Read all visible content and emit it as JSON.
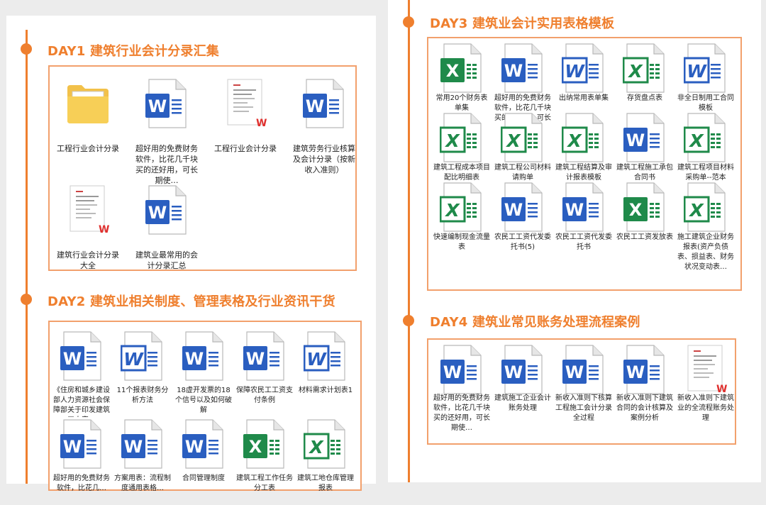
{
  "sections": {
    "day1": {
      "title": "DAY1 建筑行业会计分录汇集",
      "items": [
        {
          "label": "工程行业会计分录",
          "icon": "folder-icon"
        },
        {
          "label": "超好用的免费财务软件，比花几千块买的还好用，可长期使…",
          "icon": "word-icon"
        },
        {
          "label": "工程行业会计分录",
          "icon": "wps-document-icon"
        },
        {
          "label": "建筑劳务行业核算及会计分录（按新收入准则）",
          "icon": "word-icon"
        },
        {
          "label": "建筑行业会计分录大全",
          "icon": "wps-document-icon"
        },
        {
          "label": "建筑业最常用的会计分录汇总",
          "icon": "word-icon"
        }
      ]
    },
    "day2": {
      "title": "DAY2 建筑业相关制度、管理表格及行业资讯干货",
      "items": [
        {
          "label": "《住房和城乡建设部人力资源社会保障部关于印发建筑工人实…",
          "icon": "word-icon"
        },
        {
          "label": "11个报表财务分析方法",
          "icon": "word-old-icon"
        },
        {
          "label": "18虚开发票的18个信号以及如何破解",
          "icon": "word-icon"
        },
        {
          "label": "保障农民工工资支付条例",
          "icon": "word-icon"
        },
        {
          "label": "材料需求计划表1",
          "icon": "word-old-icon"
        },
        {
          "label": "超好用的免费财务软件，比花几…",
          "icon": "word-icon"
        },
        {
          "label": "方案用表：流程制度通用表格…",
          "icon": "word-icon"
        },
        {
          "label": "合同管理制度",
          "icon": "word-icon"
        },
        {
          "label": "建筑工程工作任务分工表",
          "icon": "excel-icon"
        },
        {
          "label": "建筑工地仓库管理报表",
          "icon": "excel-old-icon"
        }
      ]
    },
    "day3": {
      "title": "DAY3 建筑业会计实用表格模板",
      "items": [
        {
          "label": "常用20个财务表单集",
          "icon": "excel-icon"
        },
        {
          "label": "超好用的免费财务软件，比花几千块买的还好用，可长期使…",
          "icon": "word-icon"
        },
        {
          "label": "出纳常用表单集",
          "icon": "word-old-icon"
        },
        {
          "label": "存货盘点表",
          "icon": "excel-old-icon"
        },
        {
          "label": "非全日制用工合同模板",
          "icon": "word-old-icon"
        },
        {
          "label": "建筑工程成本项目配比明细表",
          "icon": "excel-old-icon"
        },
        {
          "label": "建筑工程公司材料请购单",
          "icon": "excel-old-icon"
        },
        {
          "label": "建筑工程结算及审计报表模板",
          "icon": "excel-old-icon"
        },
        {
          "label": "建筑工程施工承包合同书",
          "icon": "word-icon"
        },
        {
          "label": "建筑工程项目材料采购单--范本",
          "icon": "excel-old-icon"
        },
        {
          "label": "快速编制现金流量表",
          "icon": "excel-old-icon"
        },
        {
          "label": "农民工工资代发委托书(5)",
          "icon": "word-icon"
        },
        {
          "label": "农民工工资代发委托书",
          "icon": "word-icon"
        },
        {
          "label": "农民工工资发放表",
          "icon": "excel-icon"
        },
        {
          "label": "施工建筑企业财务报表(资产负债表、损益表、财务状况变动表…",
          "icon": "excel-old-icon"
        }
      ]
    },
    "day4": {
      "title": "DAY4 建筑业常见账务处理流程案例",
      "items": [
        {
          "label": "超好用的免费财务软件，比花几千块买的还好用，可长期使…",
          "icon": "word-icon"
        },
        {
          "label": "建筑施工企业会计账务处理",
          "icon": "word-icon"
        },
        {
          "label": "新收入准则下核算工程施工会计分录全过程",
          "icon": "word-icon"
        },
        {
          "label": "新收入准则下建筑合同的会计核算及案例分析",
          "icon": "word-icon"
        },
        {
          "label": "新收入准则下建筑业的全流程账务处理",
          "icon": "wps-document-icon"
        }
      ]
    }
  },
  "colors": {
    "accent": "#ef7f2e",
    "box_border": "#f2a06c",
    "word_blue": "#2a5ec0",
    "excel_green": "#1f8a4a"
  }
}
